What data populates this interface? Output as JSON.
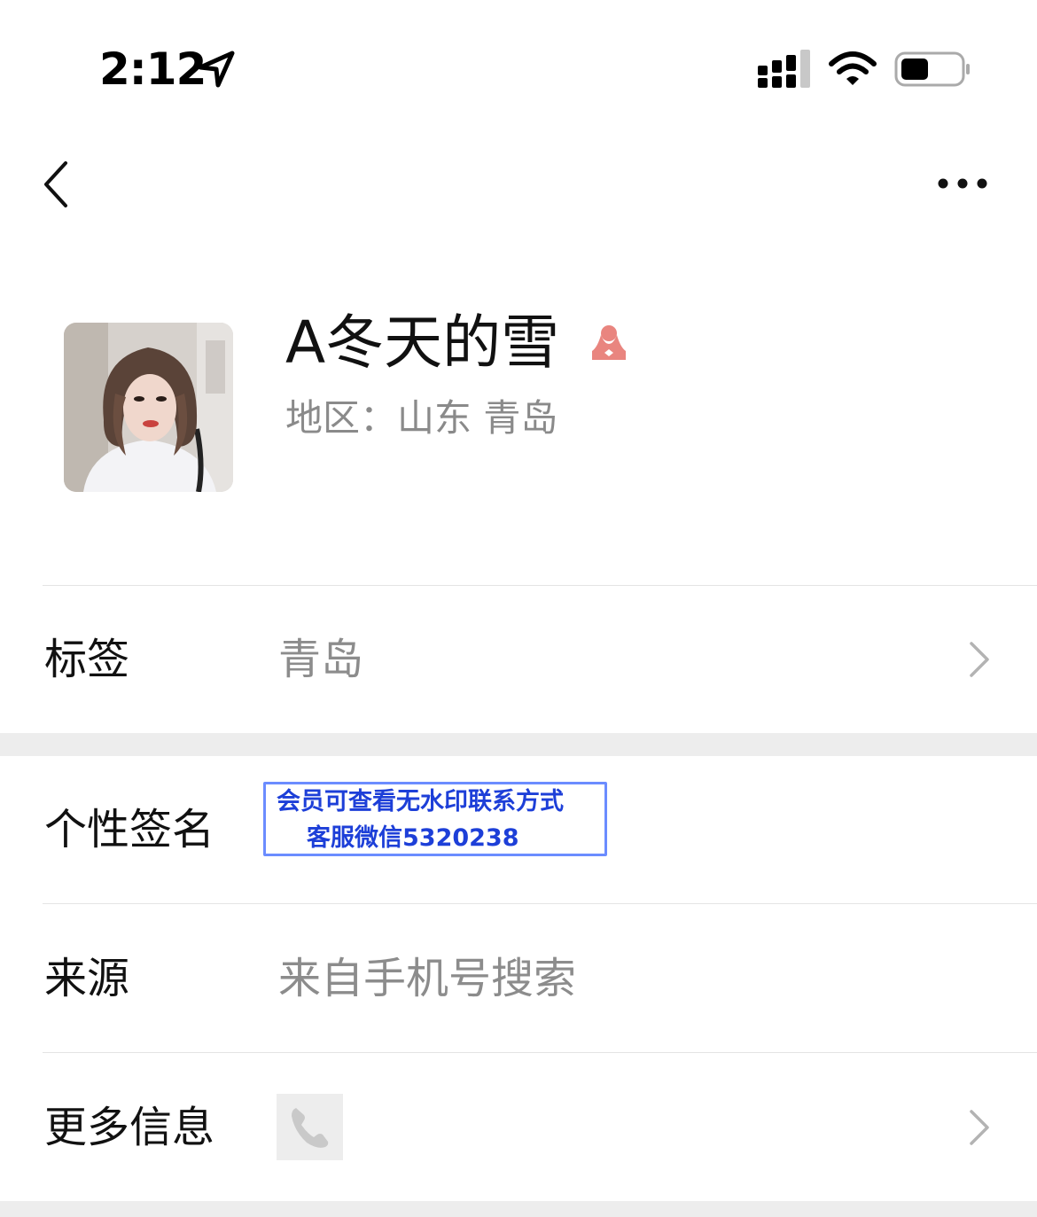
{
  "status_bar": {
    "time": "2:12",
    "icons": [
      "location-arrow-icon",
      "cellular-signal-icon",
      "wifi-icon",
      "battery-icon"
    ]
  },
  "nav": {
    "back_icon": "chevron-left-icon",
    "more_icon": "ellipsis-icon"
  },
  "profile": {
    "name": "A冬天的雪",
    "gender_icon": "female-icon",
    "region": "地区：山东 青岛"
  },
  "rows": {
    "tags": {
      "label": "标签",
      "value": "青岛"
    },
    "signature": {
      "label": "个性签名",
      "watermark_line1": "会员可查看无水印联系方式",
      "watermark_line2": "客服微信5320238"
    },
    "source": {
      "label": "来源",
      "value": "来自手机号搜索"
    },
    "more_info": {
      "label": "更多信息",
      "icon": "phone-icon"
    }
  },
  "colors": {
    "gender_icon": "#e9857f",
    "watermark_text": "#1d3fd8",
    "watermark_border": "#6b8cff",
    "secondary_text": "#8c8c8c",
    "section_gap": "#ededed"
  }
}
